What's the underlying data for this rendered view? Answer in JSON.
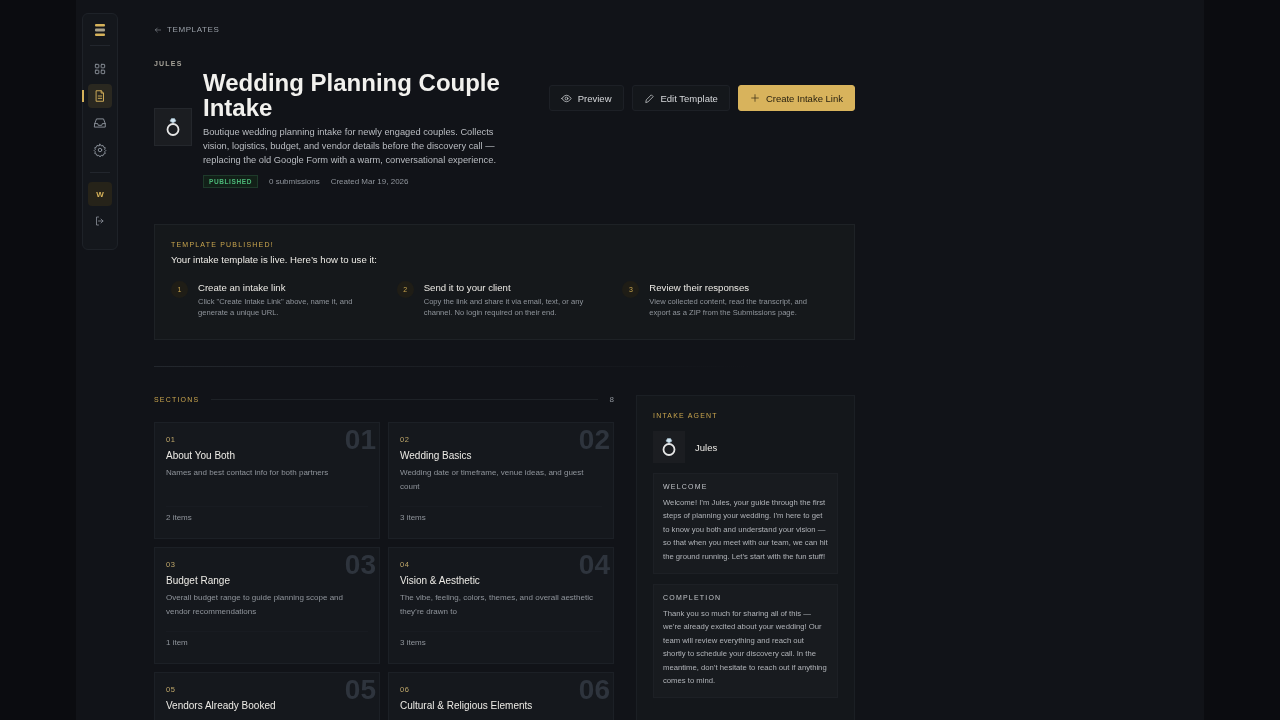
{
  "sidebar": {
    "items": [
      {
        "kind": "grid",
        "selected": false
      },
      {
        "kind": "document",
        "selected": true
      },
      {
        "kind": "inbox",
        "selected": false
      },
      {
        "kind": "settings",
        "selected": false
      }
    ],
    "avatar": "W"
  },
  "breadcrumb": "TEMPLATES",
  "header": {
    "agent_label": "JULES",
    "title": "Wedding Planning Couple Intake",
    "description": "Boutique wedding planning intake for newly engaged couples. Collects vision, logistics, budget, and vendor details before the discovery call — replacing the old Google Form with a warm, conversational experience.",
    "status": "PUBLISHED",
    "submissions": "0 submissions",
    "created": "Created Mar 19, 2026"
  },
  "actions": [
    {
      "kind": "preview",
      "label": "Preview"
    },
    {
      "kind": "edit",
      "label": "Edit Template"
    },
    {
      "kind": "create",
      "label": "Create Intake Link"
    }
  ],
  "published_notice": {
    "heading": "TEMPLATE PUBLISHED!",
    "intro": "Your intake template is live. Here’s how to use it:",
    "steps": [
      {
        "number": "1",
        "title": "Create an intake link",
        "text": "Click \"Create Intake Link\" above, name it, and generate a unique URL."
      },
      {
        "number": "2",
        "title": "Send it to your client",
        "text": "Copy the link and share it via email, text, or any channel. No login required on their end."
      },
      {
        "number": "3",
        "title": "Review their responses",
        "text": "View collected content, read the transcript, and export as a ZIP from the Submissions page."
      }
    ]
  },
  "sections": {
    "heading": "SECTIONS",
    "count": "8",
    "items": [
      {
        "number": "01",
        "watermark": "01",
        "title": "About You Both",
        "description": "Names and best contact info for both partners",
        "items": "2 items"
      },
      {
        "number": "02",
        "watermark": "02",
        "title": "Wedding Basics",
        "description": "Wedding date or timeframe, venue ideas, and guest count",
        "items": "3 items"
      },
      {
        "number": "03",
        "watermark": "03",
        "title": "Budget Range",
        "description": "Overall budget range to guide planning scope and vendor recommendations",
        "items": "1 item"
      },
      {
        "number": "04",
        "watermark": "04",
        "title": "Vision & Aesthetic",
        "description": "The vibe, feeling, colors, themes, and overall aesthetic they’re drawn to",
        "items": "3 items"
      },
      {
        "number": "05",
        "watermark": "05",
        "title": "Vendors Already Booked"
      },
      {
        "number": "06",
        "watermark": "06",
        "title": "Cultural & Religious Elements"
      }
    ]
  },
  "agent": {
    "heading": "INTAKE AGENT",
    "name": "Jules",
    "messages": [
      {
        "label": "WELCOME",
        "text": "Welcome! I’m Jules, your guide through the first steps of planning your wedding. I’m here to get to know you both and understand your vision — so that when you meet with our team, we can hit the ground running. Let’s start with the fun stuff!"
      },
      {
        "label": "COMPLETION",
        "text": "Thank you so much for sharing all of this — we’re already excited about your wedding! Our team will review everything and reach out shortly to schedule your discovery call. In the meantime, don’t hesitate to reach out if anything comes to mind."
      }
    ]
  }
}
